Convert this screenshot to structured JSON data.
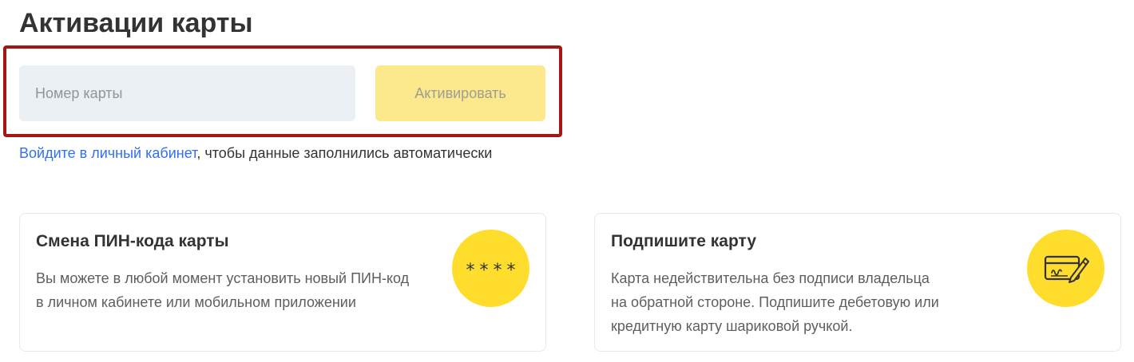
{
  "page": {
    "title": "Активации карты"
  },
  "activation_form": {
    "card_number_placeholder": "Номер карты",
    "card_number_value": "",
    "activate_label": "Активировать"
  },
  "login_hint": {
    "link_text": "Войдите в личный кабинет",
    "rest_text": ", чтобы данные заполнились автоматически"
  },
  "cards": {
    "pin": {
      "title": "Смена ПИН-кода карты",
      "text": "Вы можете в любой момент установить новый ПИН-код\nв личном кабинете или мобильном приложении",
      "icon": "pin-asterisks-icon",
      "icon_text": "****"
    },
    "sign": {
      "title": "Подпишите карту",
      "text": "Карта недействительна без подписи владельца\nна обратной стороне. Подпишите дебетовую или\nкредитную карту шариковой ручкой.",
      "icon": "card-signature-icon"
    }
  },
  "colors": {
    "highlight_border": "#a51616",
    "input_bg": "#ebf0f5",
    "button_bg_disabled": "#fce98c",
    "link": "#336fee",
    "icon_circle": "#ffdd2d"
  }
}
